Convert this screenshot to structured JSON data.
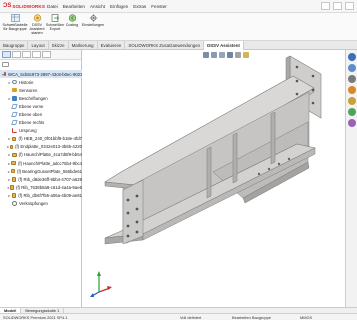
{
  "app": {
    "brand": "SOLIDWORKS",
    "menus": [
      "Datei",
      "Bearbeiten",
      "Ansicht",
      "Einfügen",
      "Extras",
      "Fenster"
    ]
  },
  "toolbar": {
    "buttons": [
      {
        "label": "Schweißtabelle für Baugruppe",
        "icon": "weld-table-icon"
      },
      {
        "label": "DSSV Assistent starten",
        "icon": "assistant-icon"
      },
      {
        "label": "Schweißen Export",
        "icon": "weld-export-icon"
      },
      {
        "label": "Costing",
        "icon": "costing-icon"
      },
      {
        "label": "Einstellungen",
        "icon": "settings-icon"
      }
    ]
  },
  "tabs": [
    "Baugruppe",
    "Layout",
    "Skizze",
    "Markierung",
    "Evaluieren",
    "SOLIDWORKS Zusatzanwendungen",
    "DSSV Assistent"
  ],
  "active_tab": "DSSV Assistent",
  "tree": {
    "items": [
      {
        "label": "WCA_5cb8c973-2897-43c8-b0ec-9023",
        "icon": "part",
        "indent": 0,
        "toggle": "▾"
      },
      {
        "label": "Historie",
        "icon": "hist",
        "indent": 1,
        "toggle": "▸"
      },
      {
        "label": "Sensoren",
        "icon": "sens",
        "indent": 1,
        "toggle": ""
      },
      {
        "label": "Beschriftungen",
        "icon": "annot",
        "indent": 1,
        "toggle": "▸"
      },
      {
        "label": "Ebene vorne",
        "icon": "plane",
        "indent": 1,
        "toggle": ""
      },
      {
        "label": "Ebene oben",
        "icon": "plane",
        "indent": 1,
        "toggle": ""
      },
      {
        "label": "Ebene rechts",
        "icon": "plane",
        "indent": 1,
        "toggle": ""
      },
      {
        "label": "Ursprung",
        "icon": "origin",
        "indent": 1,
        "toggle": ""
      },
      {
        "label": "(f) HEB_240_0f01bbf9-b18e-4fd7",
        "icon": "comp",
        "indent": 1,
        "toggle": "▸"
      },
      {
        "label": "(f) Endplatte_0342e013-4b55-4220",
        "icon": "comp",
        "indent": 1,
        "toggle": "▸"
      },
      {
        "label": "(f) Haunch/Platte_4ca7d6f9-bb54",
        "icon": "comp",
        "indent": 1,
        "toggle": "▸"
      },
      {
        "label": "(f) Haunch/Platte_adcc75b4-9bc4",
        "icon": "comp",
        "indent": 1,
        "toggle": "▸"
      },
      {
        "label": "(f) BearingGussetPlate_556bde61",
        "icon": "comp",
        "indent": 1,
        "toggle": "▸"
      },
      {
        "label": "(f) Rib_d8de36ff-9bb4-4707-a629",
        "icon": "comp",
        "indent": 1,
        "toggle": "▸"
      },
      {
        "label": "(f) Rib_7538b8a9-c61d-4a4a-9ae6",
        "icon": "comp",
        "indent": 1,
        "toggle": "▸"
      },
      {
        "label": "(f) Rib_db6f7f55-a06a-4b09-ae81",
        "icon": "comp",
        "indent": 1,
        "toggle": "▸"
      },
      {
        "label": "Verknüpfungen",
        "icon": "mate",
        "indent": 1,
        "toggle": ""
      }
    ]
  },
  "bottom_tabs": [
    "Modell",
    "Bewegungsstudie 1"
  ],
  "active_bottom_tab": "Modell",
  "status": {
    "version": "SOLIDWORKS Premium 2021 SP4.1",
    "state": "Voll definiert",
    "editing": "Bearbeiten Baugruppe",
    "units": "MMGS"
  },
  "colors": {
    "brand": "#d8232a",
    "steel_top": "#d6d5d3",
    "steel_side": "#b9b8b6",
    "steel_dark": "#8f8e8c"
  }
}
